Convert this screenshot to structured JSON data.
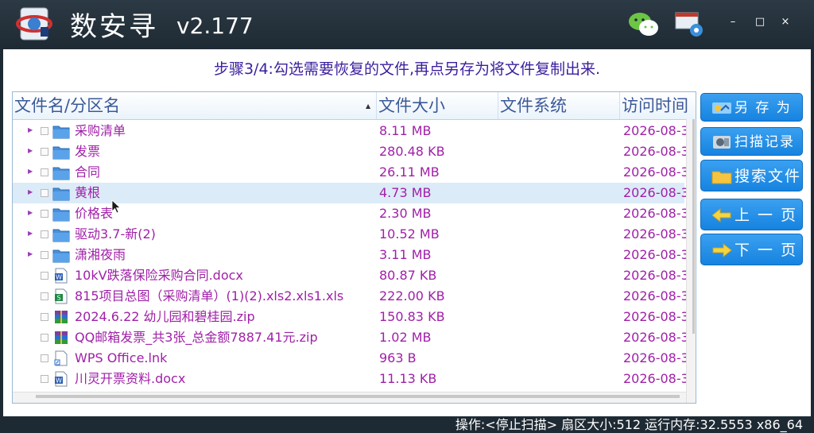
{
  "app": {
    "title": "数安寻",
    "version": "v2.177"
  },
  "window_controls": {
    "minimize": "–",
    "maximize": "□",
    "close": "×"
  },
  "step_text": "步骤3/4:勾选需要恢复的文件,再点另存为将文件复制出来.",
  "table": {
    "columns": [
      "文件名/分区名",
      "文件大小",
      "文件系统",
      "访问时间"
    ],
    "rows": [
      {
        "name": "采购清单",
        "size": "8.11 MB",
        "date": "2026-08-3",
        "icon": "folder-icon",
        "expandable": true
      },
      {
        "name": "发票",
        "size": "280.48 KB",
        "date": "2026-08-3",
        "icon": "folder-icon",
        "expandable": true
      },
      {
        "name": "合同",
        "size": "26.11 MB",
        "date": "2026-08-3",
        "icon": "folder-icon",
        "expandable": true
      },
      {
        "name": "黄根",
        "size": "4.73 MB",
        "date": "2026-08-3",
        "icon": "folder-icon",
        "expandable": true,
        "selected": true
      },
      {
        "name": "价格表",
        "size": "2.30 MB",
        "date": "2026-08-3",
        "icon": "folder-icon",
        "expandable": true
      },
      {
        "name": "驱动3.7-新(2)",
        "size": "10.52 MB",
        "date": "2026-08-3",
        "icon": "folder-icon",
        "expandable": true
      },
      {
        "name": "潇湘夜雨",
        "size": "3.11 MB",
        "date": "2026-08-3",
        "icon": "folder-icon",
        "expandable": true
      },
      {
        "name": "10kV跌落保险采购合同.docx",
        "size": "80.87 KB",
        "date": "2026-08-3",
        "icon": "word-doc-icon",
        "expandable": false
      },
      {
        "name": "815项目总图（采购清单）(1)(2).xls2.xls1.xls",
        "size": "222.00 KB",
        "date": "2026-08-3",
        "icon": "excel-sheet-icon",
        "expandable": false
      },
      {
        "name": "2024.6.22 幼儿园和碧桂园.zip",
        "size": "150.83 KB",
        "date": "2026-08-3",
        "icon": "zip-archive-icon",
        "expandable": false
      },
      {
        "name": "QQ邮箱发票_共3张_总金额7887.41元.zip",
        "size": "1.02 MB",
        "date": "2026-08-3",
        "icon": "zip-archive-icon",
        "expandable": false
      },
      {
        "name": "WPS Office.lnk",
        "size": "963 B",
        "date": "2026-08-3",
        "icon": "shortcut-icon",
        "expandable": false
      },
      {
        "name": "川灵开票资料.docx",
        "size": "11.13 KB",
        "date": "2026-08-3",
        "icon": "word-doc-icon",
        "expandable": false
      }
    ]
  },
  "buttons": [
    {
      "label": "另 存 为",
      "icon": "save-as-icon"
    },
    {
      "label": "扫描记录",
      "icon": "scan-record-icon"
    },
    {
      "label": "搜索文件",
      "icon": "folder-search-icon"
    },
    {
      "label": "上 一 页",
      "icon": "arrow-left-icon"
    },
    {
      "label": "下 一 页",
      "icon": "arrow-right-icon"
    }
  ],
  "status": "操作:<停止扫描> 扇区大小:512 运行内存:32.5553 x86_64",
  "colors": {
    "accent": "#1683e0",
    "text_purple": "#a020a8",
    "header_blue": "#3b5998",
    "titlebar": "#1e2a33"
  }
}
